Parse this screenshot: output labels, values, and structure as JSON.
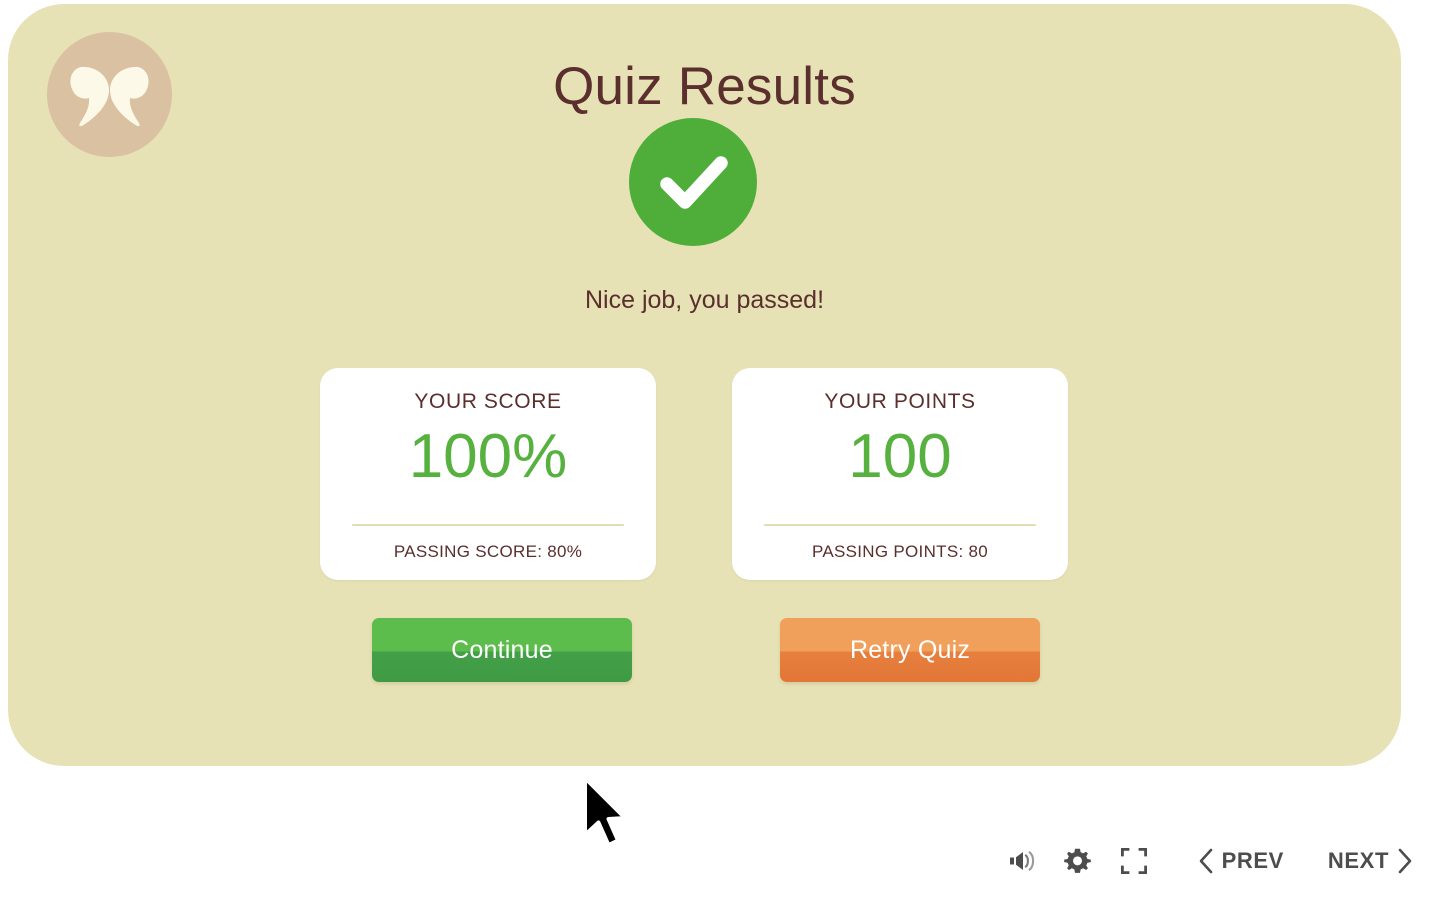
{
  "colors": {
    "panel_bg": "#e7e2b5",
    "page_bg": "#ffffff",
    "title_text": "#5a2f2d",
    "accent_green": "#4fae39",
    "value_green": "#57b13f",
    "accent_orange": "#e7803f",
    "logo_badge": "#d9c1a1",
    "card_bg": "#ffffff",
    "divider": "#e4dcb4",
    "toolbar_icon": "#4d4d4d"
  },
  "logo": {
    "icon": "quotation-marks-logo-icon"
  },
  "slide": {
    "title": "Quiz Results",
    "result_icon": "check-circle-icon",
    "message": "Nice job, you passed!"
  },
  "cards": [
    {
      "name": "score",
      "label": "YOUR SCORE",
      "value": "100%",
      "footnote": "PASSING SCORE: 80%"
    },
    {
      "name": "points",
      "label": "YOUR POINTS",
      "value": "100",
      "footnote": "PASSING POINTS: 80"
    }
  ],
  "actions": {
    "continue_label": "Continue",
    "retry_label": "Retry Quiz"
  },
  "toolbar": {
    "volume_icon": "volume-speaker-icon",
    "settings_icon": "gear-icon",
    "fullscreen_icon": "fullscreen-expand-icon",
    "prev_label": "PREV",
    "prev_icon": "chevron-left-icon",
    "next_label": "NEXT",
    "next_icon": "chevron-right-icon"
  },
  "cursor": {
    "icon": "arrow-pointer-cursor"
  }
}
